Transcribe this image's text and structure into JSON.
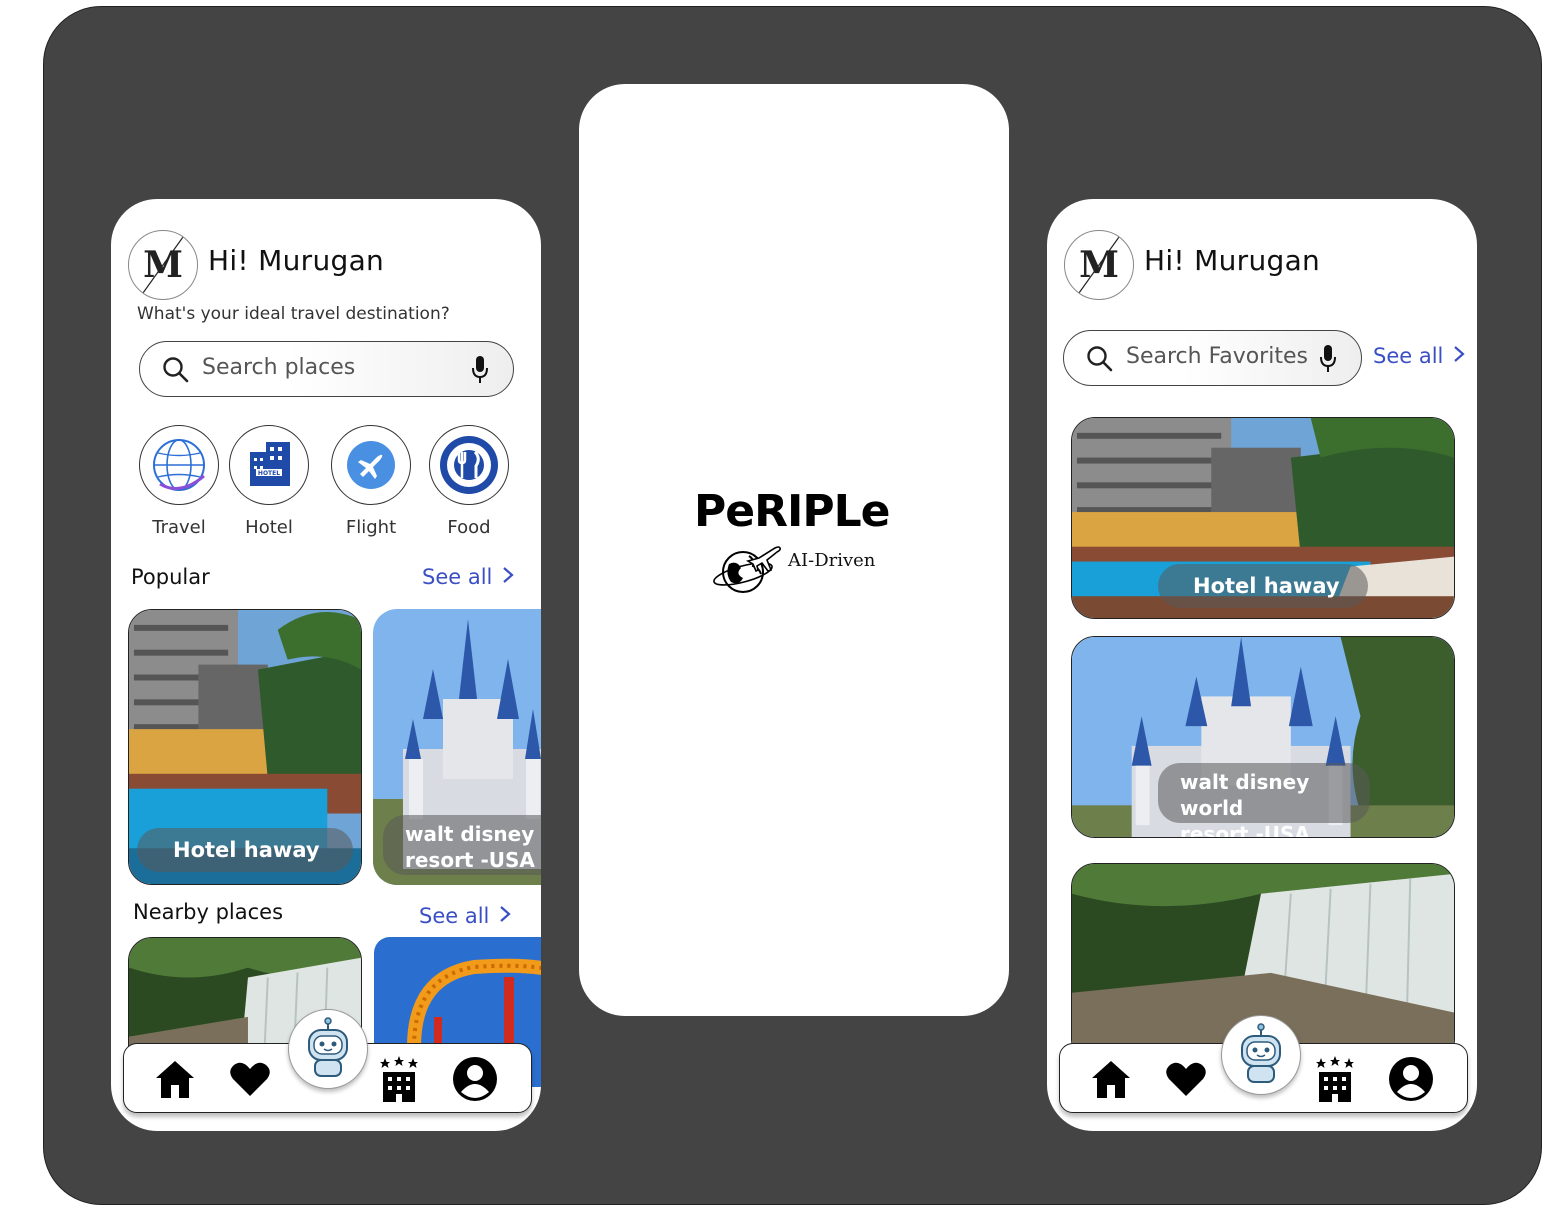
{
  "left_screen": {
    "greeting": "Hi! Murugan",
    "avatar_letter": "M",
    "subtitle": "What's your ideal travel destination?",
    "search_placeholder": "Search places",
    "categories": [
      {
        "label": "Travel",
        "icon": "globe-icon"
      },
      {
        "label": "Hotel",
        "icon": "hotel-building-icon"
      },
      {
        "label": "Flight",
        "icon": "airplane-icon"
      },
      {
        "label": "Food",
        "icon": "plate-fork-knife-icon"
      }
    ],
    "popular_title": "Popular",
    "popular_see_all": "See all",
    "popular_cards": [
      {
        "title": "Hotel haway"
      },
      {
        "title_line1": "walt disney w",
        "title_line2": "resort -USA"
      }
    ],
    "nearby_title": "Nearby places",
    "nearby_see_all": "See all"
  },
  "splash_screen": {
    "brand": "PeRIPLe",
    "tagline": "AI-Driven"
  },
  "right_screen": {
    "greeting": "Hi! Murugan",
    "avatar_letter": "M",
    "search_placeholder": "Search Favorites",
    "see_all": "See all",
    "cards": [
      {
        "title": "Hotel haway"
      },
      {
        "title_line1": "walt disney world",
        "title_line2": "resort -USA"
      }
    ]
  },
  "navbar_icons": [
    "home-icon",
    "heart-icon",
    "robot-assistant-icon",
    "hotel-stars-icon",
    "profile-icon"
  ],
  "colors": {
    "board": "#444444",
    "link": "#3a4fc4",
    "pill": "rgba(90,90,90,0.55)"
  }
}
